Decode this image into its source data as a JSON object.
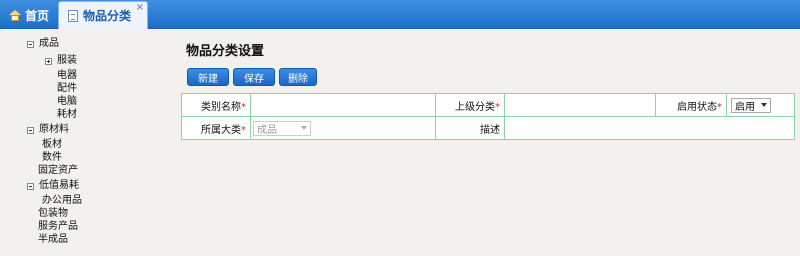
{
  "tabs": [
    {
      "label": "首页",
      "icon": "home-icon"
    },
    {
      "label": "物品分类",
      "icon": "page-icon",
      "close": "×"
    }
  ],
  "tree": [
    {
      "label": "成品",
      "toggle": "minus"
    },
    {
      "label": "服装",
      "toggle": "plus"
    },
    {
      "label": "电器"
    },
    {
      "label": "配件"
    },
    {
      "label": "电脑"
    },
    {
      "label": "耗材"
    },
    {
      "label": "原材料",
      "toggle": "minus"
    },
    {
      "label": "板材"
    },
    {
      "label": "数件"
    },
    {
      "label": "固定资产"
    },
    {
      "label": "低值易耗",
      "toggle": "minus"
    },
    {
      "label": "办公用品"
    },
    {
      "label": "包装物"
    },
    {
      "label": "服务产品"
    },
    {
      "label": "半成品"
    }
  ],
  "main": {
    "title": "物品分类设置",
    "buttons": {
      "new": "新建",
      "save": "保存",
      "delete": "删除"
    },
    "form": {
      "required_mark": "*",
      "name_label": "类别名称",
      "parent_label": "上级分类",
      "status_label": "启用状态",
      "status_value": "启用",
      "major_label": "所属大类",
      "major_value": "成品",
      "desc_label": "描述"
    }
  }
}
